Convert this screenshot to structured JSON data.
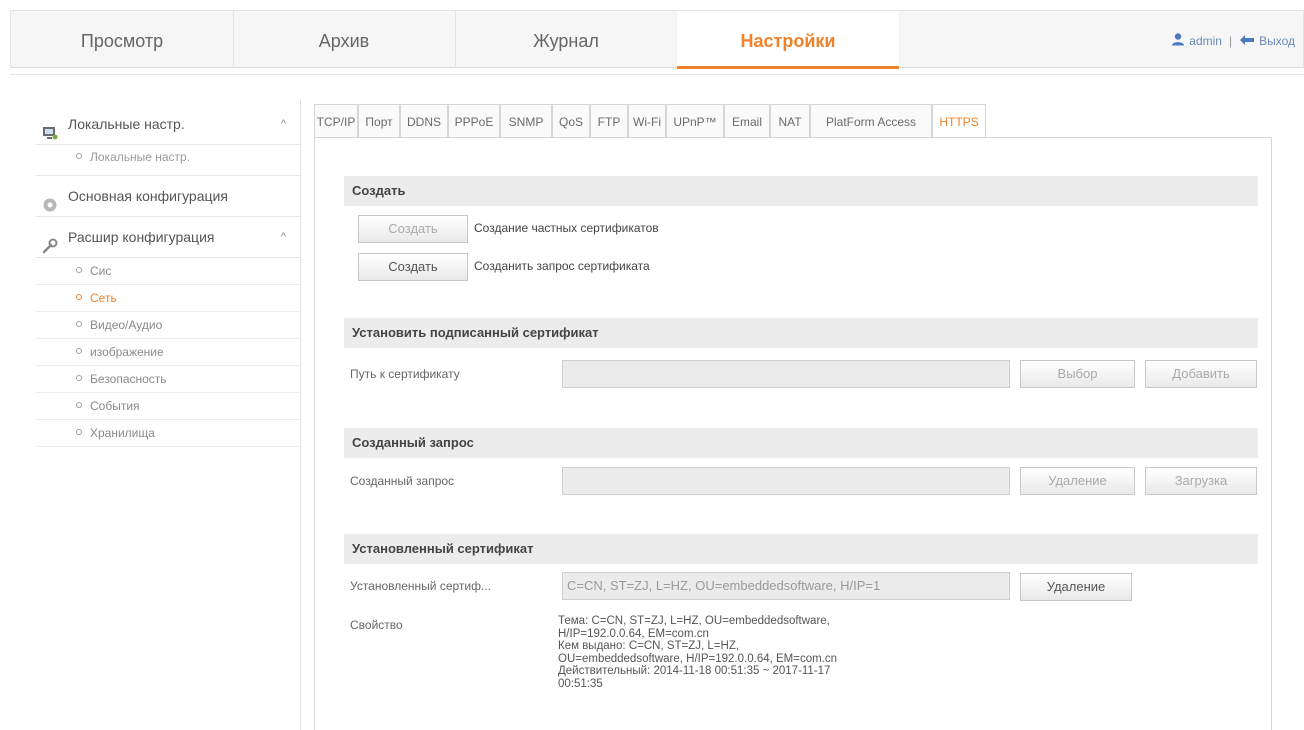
{
  "colors": {
    "accent": "#f0822c",
    "link": "#6a8ab8"
  },
  "topnav": {
    "tabs": [
      {
        "label": "Просмотр"
      },
      {
        "label": "Архив"
      },
      {
        "label": "Журнал"
      },
      {
        "label": "Настройки"
      }
    ],
    "active": "Настройки",
    "user": "admin",
    "separator": "|",
    "logout": "Выход",
    "icons": [
      "user-icon",
      "logout-icon"
    ]
  },
  "sidebar": {
    "groups": [
      {
        "label": "Локальные настр.",
        "icon": "monitor-icon",
        "chevron": "^",
        "items": [
          "Локальные настр."
        ]
      },
      {
        "label": "Основная конфигурация",
        "icon": "gear-icon"
      },
      {
        "label": "Расшир конфигурация",
        "icon": "wrench-icon",
        "chevron": "^",
        "items": [
          "Сис",
          "Сеть",
          "Видео/Аудио",
          "изображение",
          "Безопасность",
          "События",
          "Хранилища"
        ]
      }
    ],
    "active_item": "Сеть"
  },
  "tabs": [
    "TCP/IP",
    "Порт",
    "DDNS",
    "PPPoE",
    "SNMP",
    "QoS",
    "FTP",
    "Wi-Fi",
    "UPnP™",
    "Email",
    "NAT",
    "PlatForm Access",
    "HTTPS"
  ],
  "active_tab": "HTTPS",
  "create": {
    "title": "Создать",
    "rows": [
      {
        "button": "Создать",
        "text": "Создание частных сертификатов",
        "disabled": true
      },
      {
        "button": "Создать",
        "text": "Созданить запрос сертификата",
        "disabled": false
      }
    ]
  },
  "install_signed": {
    "title": "Установить подписанный сертификат",
    "label": "Путь к сертификату",
    "value": "",
    "browse": "Выбор",
    "install": "Добавить"
  },
  "created_request": {
    "title": "Созданный запрос",
    "label": "Созданный запрос",
    "value": "",
    "delete": "Удаление",
    "download": "Загрузка"
  },
  "installed_cert": {
    "title": "Установленный сертификат",
    "label": "Установленный сертиф...",
    "value": "C=CN, ST=ZJ, L=HZ, OU=embeddedsoftware, H/IP=1",
    "delete": "Удаление",
    "props_label": "Свойство",
    "props": [
      "Тема: C=CN, ST=ZJ, L=HZ, OU=embeddedsoftware,",
      "H/IP=192.0.0.64, EM=com.cn",
      "Кем выдано: C=CN, ST=ZJ, L=HZ,",
      "OU=embeddedsoftware, H/IP=192.0.0.64, EM=com.cn",
      "Действительный: 2014-11-18 00:51:35 ~ 2017-11-17",
      "00:51:35"
    ]
  }
}
